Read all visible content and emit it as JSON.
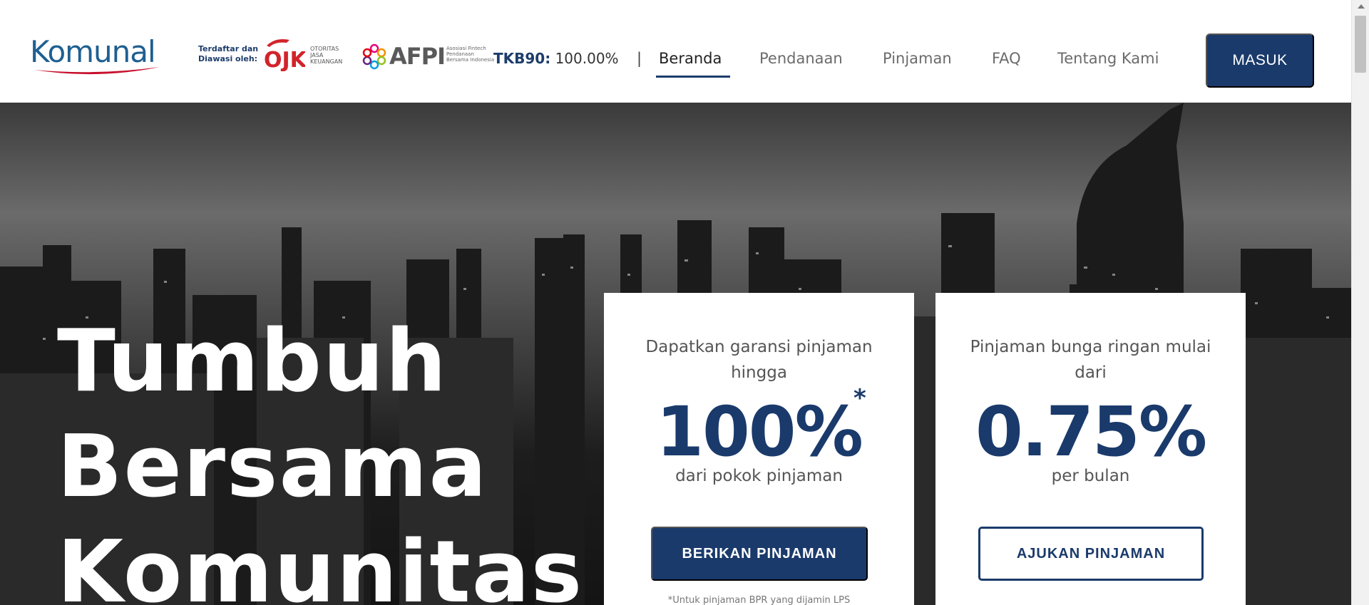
{
  "header": {
    "logo": "Komunal",
    "registered_label": "Terdaftar dan Diawasi oleh:",
    "ojk_mark": "OJK",
    "ojk_text": "OTORITAS JASA KEUANGAN",
    "afpi_word": "AFPI",
    "afpi_sub": "Asosiasi Fintech Pendanaan Bersama Indonesia",
    "tkb_label": "TKB90:",
    "tkb_value": "100.00%",
    "separator": "|",
    "nav": [
      {
        "label": "Beranda",
        "active": true
      },
      {
        "label": "Pendanaan",
        "active": false
      },
      {
        "label": "Pinjaman",
        "active": false
      },
      {
        "label": "FAQ",
        "active": false
      },
      {
        "label": "Tentang Kami",
        "active": false
      }
    ],
    "login_label": "MASUK"
  },
  "hero": {
    "headline": [
      "Tumbuh",
      "Bersama",
      "Komunitas"
    ],
    "cards": [
      {
        "caption": "Dapatkan garansi pinjaman hingga",
        "big": "100%",
        "star": "*",
        "sub": "dari pokok pinjaman",
        "button": "BERIKAN PINJAMAN",
        "note": "*Untuk pinjaman BPR yang dijamin LPS"
      },
      {
        "caption": "Pinjaman bunga ringan mulai dari",
        "big": "0.75%",
        "sub": "per bulan",
        "button": "AJUKAN PINJAMAN"
      }
    ]
  },
  "colors": {
    "brand_navy": "#1a3a6b",
    "logo_blue": "#1e5f91",
    "logo_red": "#c8102e",
    "ojk_red": "#d2232a"
  }
}
